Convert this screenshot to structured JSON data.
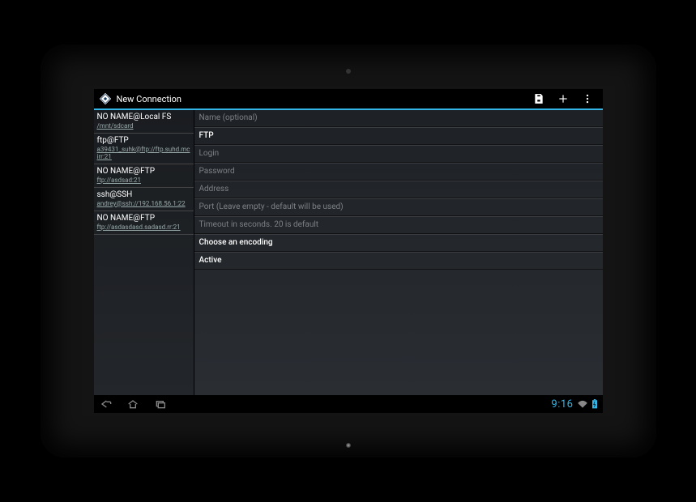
{
  "header": {
    "title": "New Connection"
  },
  "sidebar": {
    "items": [
      {
        "title": "NO NAME@Local FS",
        "sub": "/mnt/sdcard"
      },
      {
        "title": "ftp@FTP",
        "sub": "a39431_suhk@ftp://ftp.suhd.mcirr:21"
      },
      {
        "title": "NO NAME@FTP",
        "sub": "ftp://asdsad:21"
      },
      {
        "title": "ssh@SSH",
        "sub": "andrey@ssh://192.168.56.1:22"
      },
      {
        "title": "NO NAME@FTP",
        "sub": "ftp://asdasdasd.sadasd.rr:21"
      }
    ]
  },
  "form": {
    "name_placeholder": "Name (optional)",
    "protocol": "FTP",
    "login_placeholder": "Login",
    "password_placeholder": "Password",
    "address_placeholder": "Address",
    "port_placeholder": "Port (Leave empty - default will be used)",
    "timeout_placeholder": "Timeout in seconds. 20 is default",
    "encoding_label": "Choose an encoding",
    "mode_label": "Active"
  },
  "status": {
    "clock": "9:16"
  }
}
